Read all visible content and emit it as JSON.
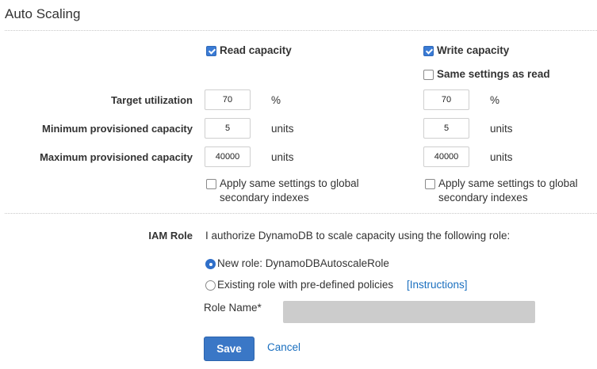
{
  "header": {
    "title": "Auto Scaling"
  },
  "read": {
    "checkbox_label": "Read capacity",
    "target_utilization": "70",
    "min_capacity": "5",
    "max_capacity": "40000",
    "apply_global_line1": "Apply same settings to global",
    "apply_global_line2": "secondary indexes"
  },
  "write": {
    "checkbox_label": "Write capacity",
    "same_settings_label": "Same settings as read",
    "target_utilization": "70",
    "min_capacity": "5",
    "max_capacity": "40000",
    "apply_global_line1": "Apply same settings to global",
    "apply_global_line2": "secondary indexes"
  },
  "labels": {
    "target_utilization": "Target utilization",
    "min_capacity": "Minimum provisioned capacity",
    "max_capacity": "Maximum provisioned capacity",
    "percent_unit": "%",
    "units_unit": "units"
  },
  "iam": {
    "label": "IAM Role",
    "description": "I authorize DynamoDB to scale capacity using the following role:",
    "new_role": "New role: DynamoDBAutoscaleRole",
    "existing_role": "Existing role with pre-defined policies",
    "instructions_link": "[Instructions]",
    "role_name_label": "Role Name*",
    "role_name_value": ""
  },
  "actions": {
    "save": "Save",
    "cancel": "Cancel"
  },
  "colors": {
    "accent": "#3a77c6",
    "link": "#1a6fbf"
  }
}
